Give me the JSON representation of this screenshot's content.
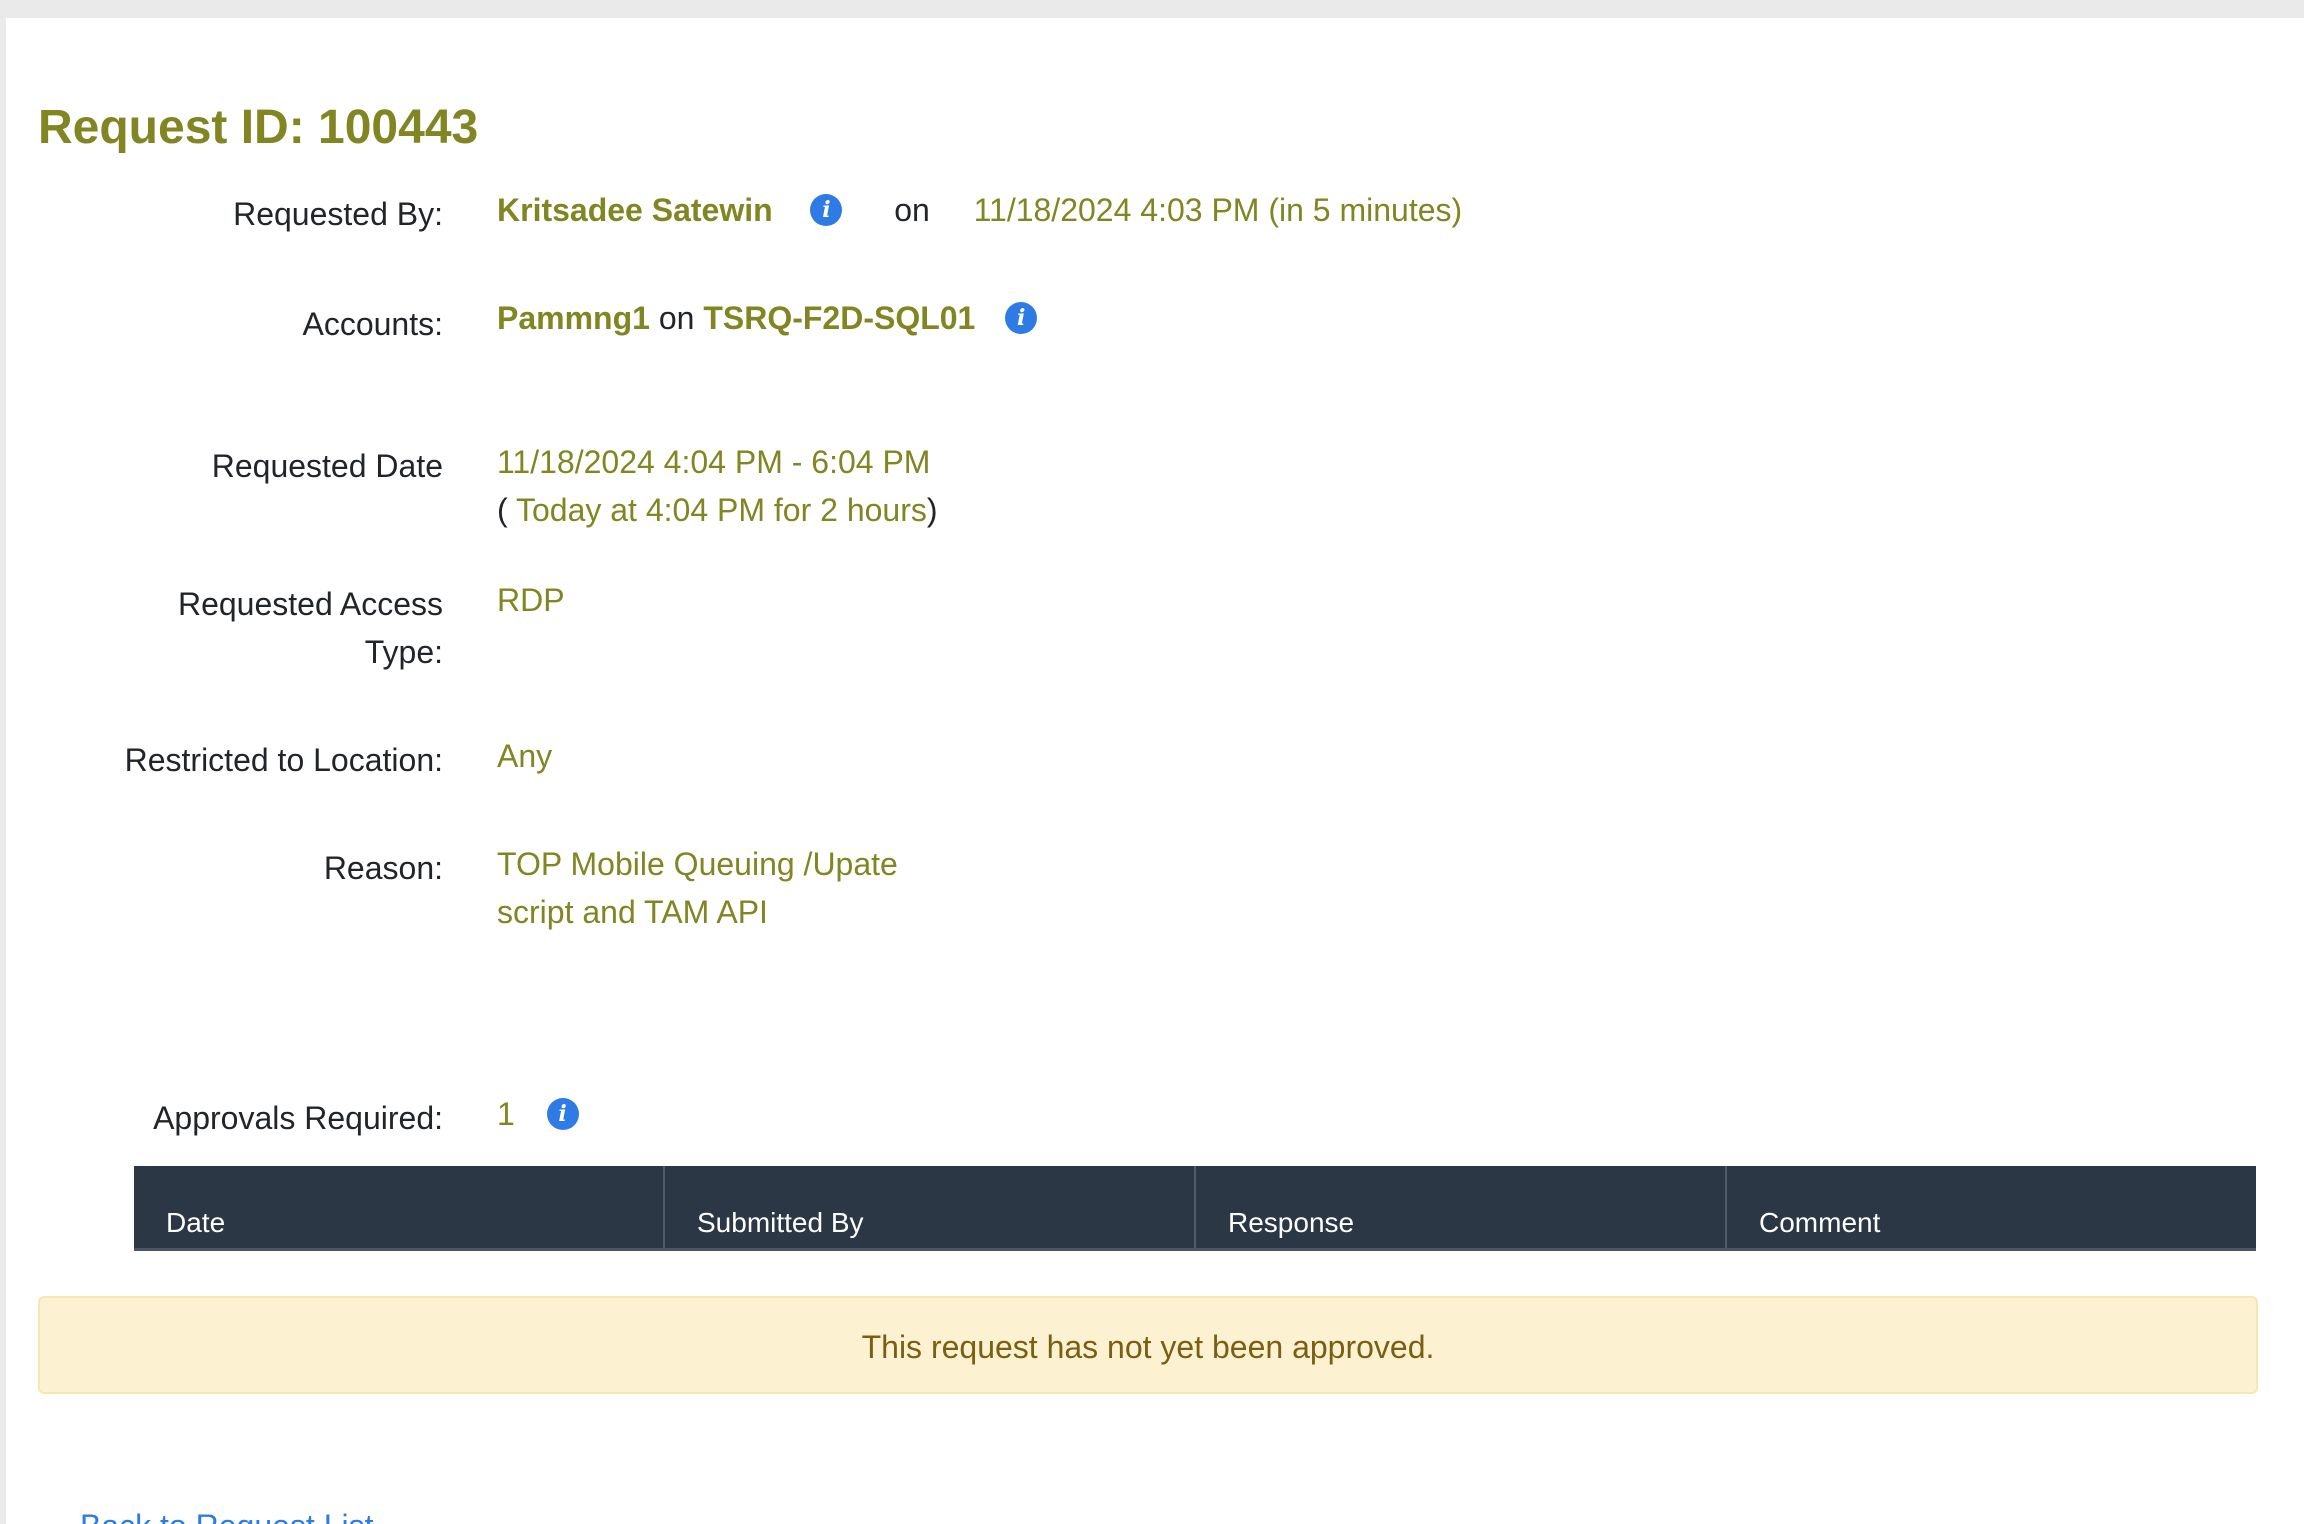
{
  "request": {
    "title": "Request ID: 100443"
  },
  "requested_by": {
    "label": "Requested By:",
    "name": "Kritsadee Satewin",
    "on": "on",
    "datetime": "11/18/2024 4:03 PM (in 5 minutes)"
  },
  "accounts": {
    "label": "Accounts:",
    "account": "Pammng1",
    "on": "on",
    "server": "TSRQ-F2D-SQL01"
  },
  "requested_date": {
    "label": "Requested Date",
    "range": "11/18/2024 4:04 PM - 6:04 PM",
    "open_paren": "( ",
    "relative": "Today at 4:04 PM for 2 hours",
    "close_paren": ")"
  },
  "access_type": {
    "label_line1": "Requested Access",
    "label_line2": "Type:",
    "value": "RDP"
  },
  "location": {
    "label": "Restricted to Location:",
    "value": "Any"
  },
  "reason": {
    "label": "Reason:",
    "line1": "TOP Mobile Queuing /Upate",
    "line2": "script and TAM API"
  },
  "approvals": {
    "label": "Approvals Required:",
    "value": "1"
  },
  "table": {
    "columns": [
      "Date",
      "Submitted By",
      "Response",
      "Comment"
    ]
  },
  "alert": {
    "message": "This request has not yet been approved."
  },
  "back_link": {
    "label": "Back to Request List"
  },
  "info_icon_glyph": "i",
  "colors": {
    "accent": "#818522",
    "info": "#2f7be6",
    "table_header": "#2b3744",
    "alert_bg": "#fcf2d1",
    "alert_text": "#7a5f12"
  }
}
